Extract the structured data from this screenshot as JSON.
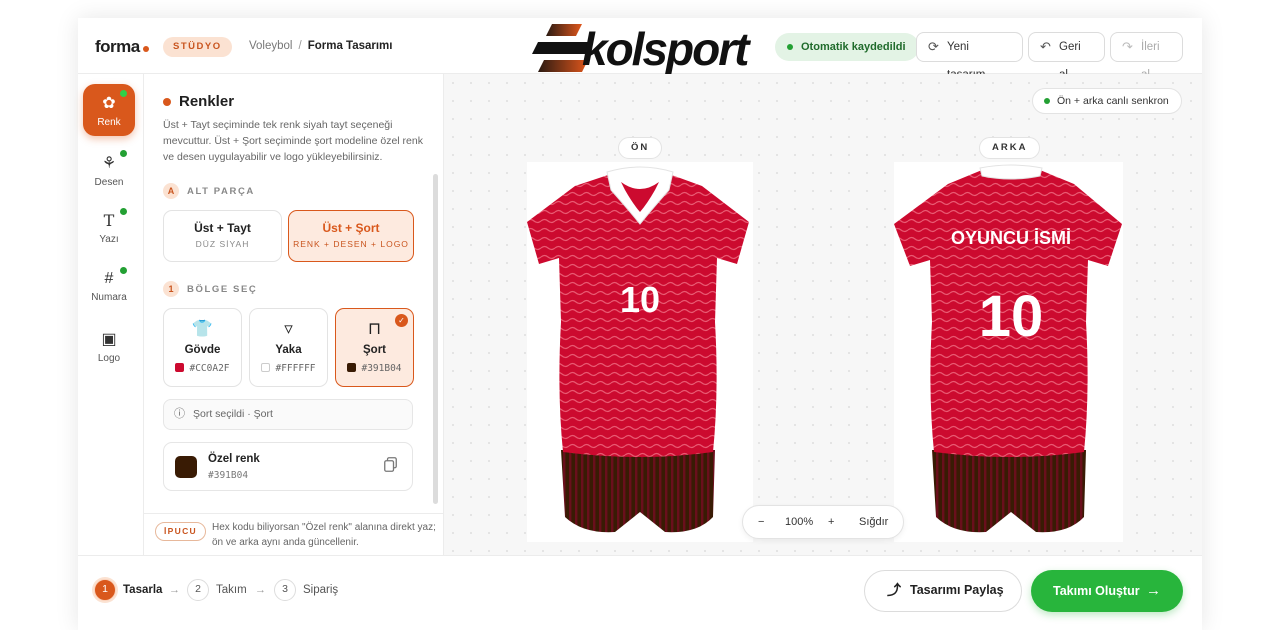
{
  "header": {
    "logo": "forma",
    "studio_badge": "STÜDYO",
    "breadcrumb": [
      "Voleybol",
      "Forma Tasarımı"
    ],
    "brand": "kolsport",
    "autosave": "Otomatik kaydedildi",
    "new_design": "Yeni tasarım",
    "undo": "Geri al",
    "redo": "İleri al"
  },
  "rail": [
    {
      "label": "Renk",
      "icon": "palette-icon",
      "active": true
    },
    {
      "label": "Desen",
      "icon": "pattern-icon"
    },
    {
      "label": "Yazı",
      "icon": "text-icon"
    },
    {
      "label": "Numara",
      "icon": "hash-icon"
    },
    {
      "label": "Logo",
      "icon": "image-icon"
    }
  ],
  "panel": {
    "title": "Renkler",
    "description": "Üst + Tayt seçiminde tek renk siyah tayt seçeneği mevcuttur. Üst + Şort seçiminde şort modeline özel renk ve desen uygulayabilir ve logo yükleyebilirsiniz.",
    "section_a": {
      "num": "A",
      "title": "ALT PARÇA"
    },
    "bottom_options": [
      {
        "title": "Üst + Tayt",
        "sub": "DÜZ SİYAH"
      },
      {
        "title": "Üst + Şort",
        "sub": "RENK + DESEN + LOGO",
        "selected": true
      }
    ],
    "section_1": {
      "num": "1",
      "title": "BÖLGE SEÇ"
    },
    "regions": [
      {
        "name": "Gövde",
        "hex": "#CC0A2F",
        "icon": "shirt-icon"
      },
      {
        "name": "Yaka",
        "hex": "#FFFFFF",
        "icon": "collar-icon"
      },
      {
        "name": "Şort",
        "hex": "#391B04",
        "icon": "shorts-icon",
        "selected": true
      }
    ],
    "selected_info": "Şort seçildi · Şort",
    "custom_color": {
      "label": "Özel renk",
      "hex": "#391B04"
    },
    "tip": {
      "label": "İPUCU",
      "text": "Hex kodu biliyorsan \"Özel renk\" alanına direkt yaz; ön ve arka aynı anda güncellenir."
    }
  },
  "canvas": {
    "sync": "Ön + arka canlı senkron",
    "front_label": "ÖN",
    "back_label": "ARKA",
    "player_name": "OYUNCU İSMİ",
    "number": "10",
    "zoom_minus": "−",
    "zoom_value": "100%",
    "zoom_plus": "+",
    "fit": "Sığdır"
  },
  "footer": {
    "steps": [
      {
        "num": "1",
        "label": "Tasarla",
        "active": true
      },
      {
        "num": "2",
        "label": "Takım"
      },
      {
        "num": "3",
        "label": "Sipariş"
      }
    ],
    "share": "Tasarımı Paylaş",
    "create": "Takımı Oluştur"
  },
  "colors": {
    "accent": "#d9581c",
    "body": "#CC0A2F",
    "collar": "#FFFFFF",
    "shorts": "#391B04",
    "success": "#28b53c"
  }
}
